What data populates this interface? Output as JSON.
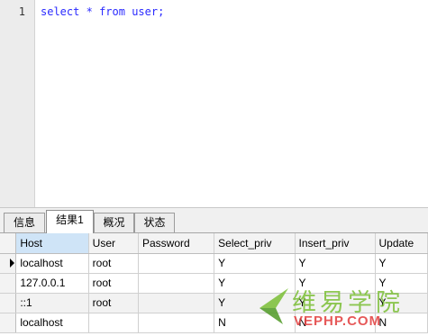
{
  "editor": {
    "line_number": "1",
    "tokens": {
      "kw_select": "select",
      "star": "*",
      "kw_from": "from",
      "table": "user",
      "semicolon": ";"
    }
  },
  "tabs": [
    {
      "label": "信息"
    },
    {
      "label": "结果1"
    },
    {
      "label": "概况"
    },
    {
      "label": "状态"
    }
  ],
  "grid": {
    "columns": [
      "Host",
      "User",
      "Password",
      "Select_priv",
      "Insert_priv",
      "Update"
    ],
    "rows": [
      [
        "localhost",
        "root",
        "",
        "Y",
        "Y",
        "Y"
      ],
      [
        "127.0.0.1",
        "root",
        "",
        "Y",
        "Y",
        "Y"
      ],
      [
        "::1",
        "root",
        "",
        "Y",
        "Y",
        "Y"
      ],
      [
        "localhost",
        "",
        "",
        "N",
        "N",
        "N"
      ]
    ]
  },
  "watermark": {
    "title": "维易学院",
    "subtitle": "VEPHP.COM"
  },
  "colors": {
    "keyword": "#2a2aff",
    "header_selected": "#cfe4f7",
    "watermark_green": "#7bbf35",
    "watermark_red": "#e23b3b"
  }
}
